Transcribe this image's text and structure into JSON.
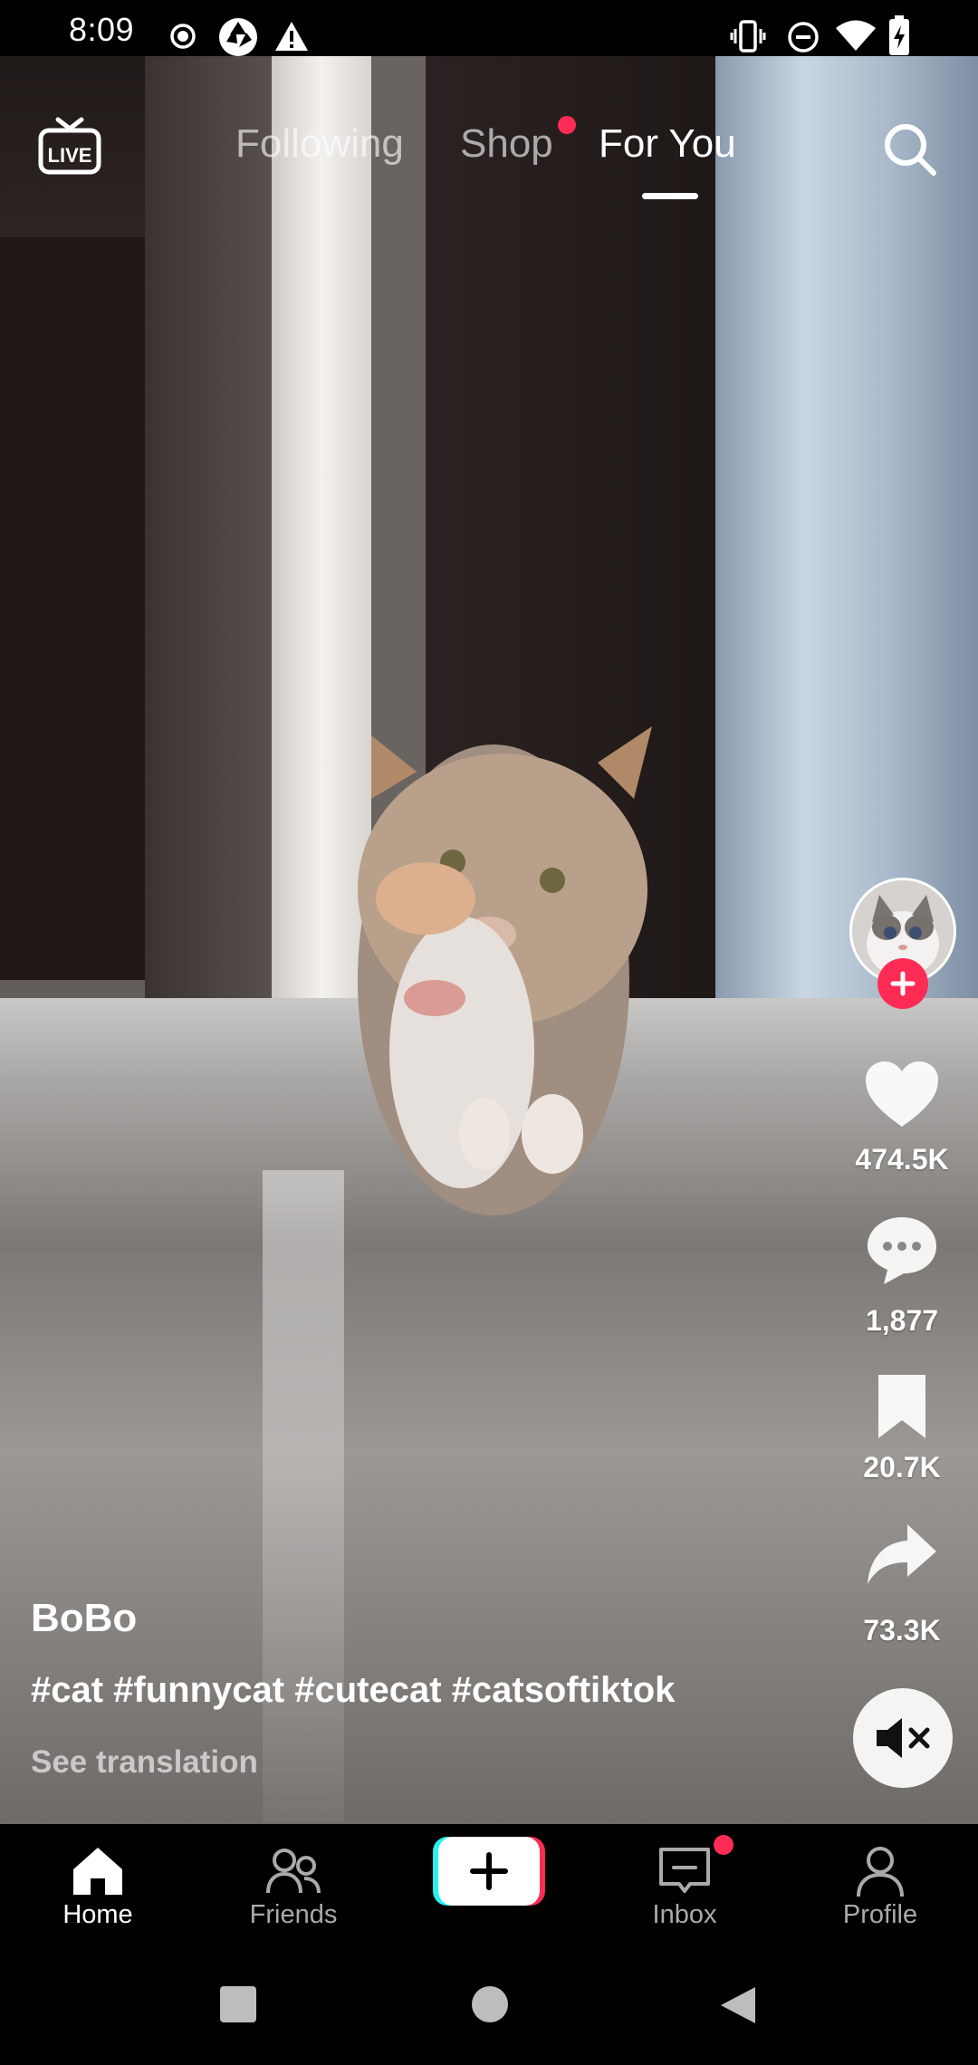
{
  "status_bar": {
    "time": "8:09",
    "left_icons": [
      "record-icon",
      "camera-shutter-icon",
      "warning-icon"
    ],
    "right_icons": [
      "vibrate-icon",
      "do-not-disturb-icon",
      "wifi-icon",
      "battery-charging-icon"
    ]
  },
  "top_nav": {
    "live_label": "LIVE",
    "tabs": [
      {
        "label": "Following",
        "active": false
      },
      {
        "label": "Shop",
        "active": false,
        "dot": true
      },
      {
        "label": "For You",
        "active": true
      }
    ],
    "search_icon": "search-icon"
  },
  "actions": {
    "likes": "474.5K",
    "comments": "1,877",
    "saves": "20.7K",
    "shares": "73.3K"
  },
  "video": {
    "username": "BoBo",
    "caption": "#cat #funnycat #cutecat #catsoftiktok",
    "translation_link": "See translation",
    "muted": true
  },
  "bottom_nav": {
    "items": [
      {
        "label": "Home",
        "icon": "home-icon",
        "active": true
      },
      {
        "label": "Friends",
        "icon": "friends-icon",
        "active": false
      },
      {
        "label": "",
        "icon": "create-plus-icon",
        "active": false
      },
      {
        "label": "Inbox",
        "icon": "inbox-icon",
        "active": false,
        "dot": true
      },
      {
        "label": "Profile",
        "icon": "profile-icon",
        "active": false
      }
    ]
  },
  "colors": {
    "accent": "#fe2c55",
    "cyan": "#25f4ee",
    "background": "#000000"
  }
}
